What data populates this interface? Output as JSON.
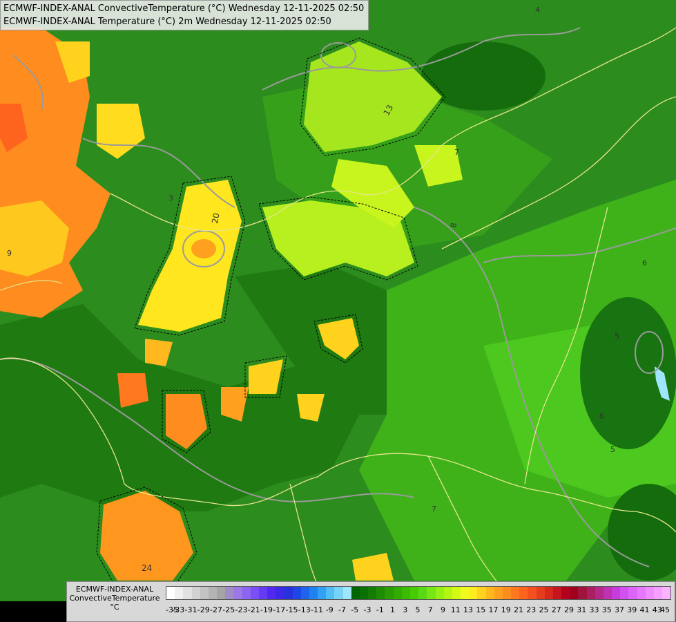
{
  "title": {
    "line1": "ECMWF-INDEX-ANAL ConvectiveTemperature (°C) Wednesday 12-11-2025 02:50",
    "line2": "ECMWF-INDEX-ANAL Temperature (°C) 2m Wednesday 12-11-2025 02:50"
  },
  "legend": {
    "model": "ECMWF-INDEX-ANAL",
    "variable": "ConvectiveTemperature",
    "unit": "°C",
    "ticks": [
      "-35",
      "-33",
      "-31",
      "-29",
      "-27",
      "-25",
      "-23",
      "-21",
      "-19",
      "-17",
      "-15",
      "-13",
      "-11",
      "-9",
      "-7",
      "-5",
      "-3",
      "-1",
      "1",
      "3",
      "5",
      "7",
      "9",
      "11",
      "13",
      "15",
      "17",
      "19",
      "21",
      "23",
      "25",
      "27",
      "29",
      "31",
      "33",
      "35",
      "37",
      "39",
      "41",
      "43",
      "45"
    ],
    "colors": [
      "#ffffff",
      "#f0f0f0",
      "#e1e1e1",
      "#d2d2d2",
      "#c3c3c3",
      "#b4b4b4",
      "#a5a5a5",
      "#a08cc8",
      "#9a78e6",
      "#8c64f0",
      "#7850f5",
      "#643cf5",
      "#5028f0",
      "#3c28e6",
      "#2832dc",
      "#1e46e6",
      "#1e64eb",
      "#1e82f0",
      "#32a0f5",
      "#50bef5",
      "#78d2f5",
      "#a0e6fa",
      "#006400",
      "#0a7000",
      "#147c00",
      "#1e8c00",
      "#289c00",
      "#32ac00",
      "#3cbc00",
      "#46cc00",
      "#5ad814",
      "#78e614",
      "#96f014",
      "#b4f514",
      "#d2fa14",
      "#f0fa1e",
      "#ffeb1e",
      "#ffd21e",
      "#ffb91e",
      "#ffa01e",
      "#ff8c1e",
      "#ff781e",
      "#ff641e",
      "#f5501e",
      "#e63c1e",
      "#d7281e",
      "#c8141e",
      "#b4001e",
      "#a0001e",
      "#a0143c",
      "#aa1e64",
      "#b4288c",
      "#be32b4",
      "#c83cdc",
      "#d250f0",
      "#dc64fa",
      "#e678ff",
      "#f08cff",
      "#f5a0ff",
      "#fab4ff"
    ]
  },
  "map_labels": [
    "20",
    "24",
    "13",
    "7",
    "5",
    "6",
    "9",
    "8",
    "6",
    "5",
    "4",
    "3",
    "7"
  ]
}
